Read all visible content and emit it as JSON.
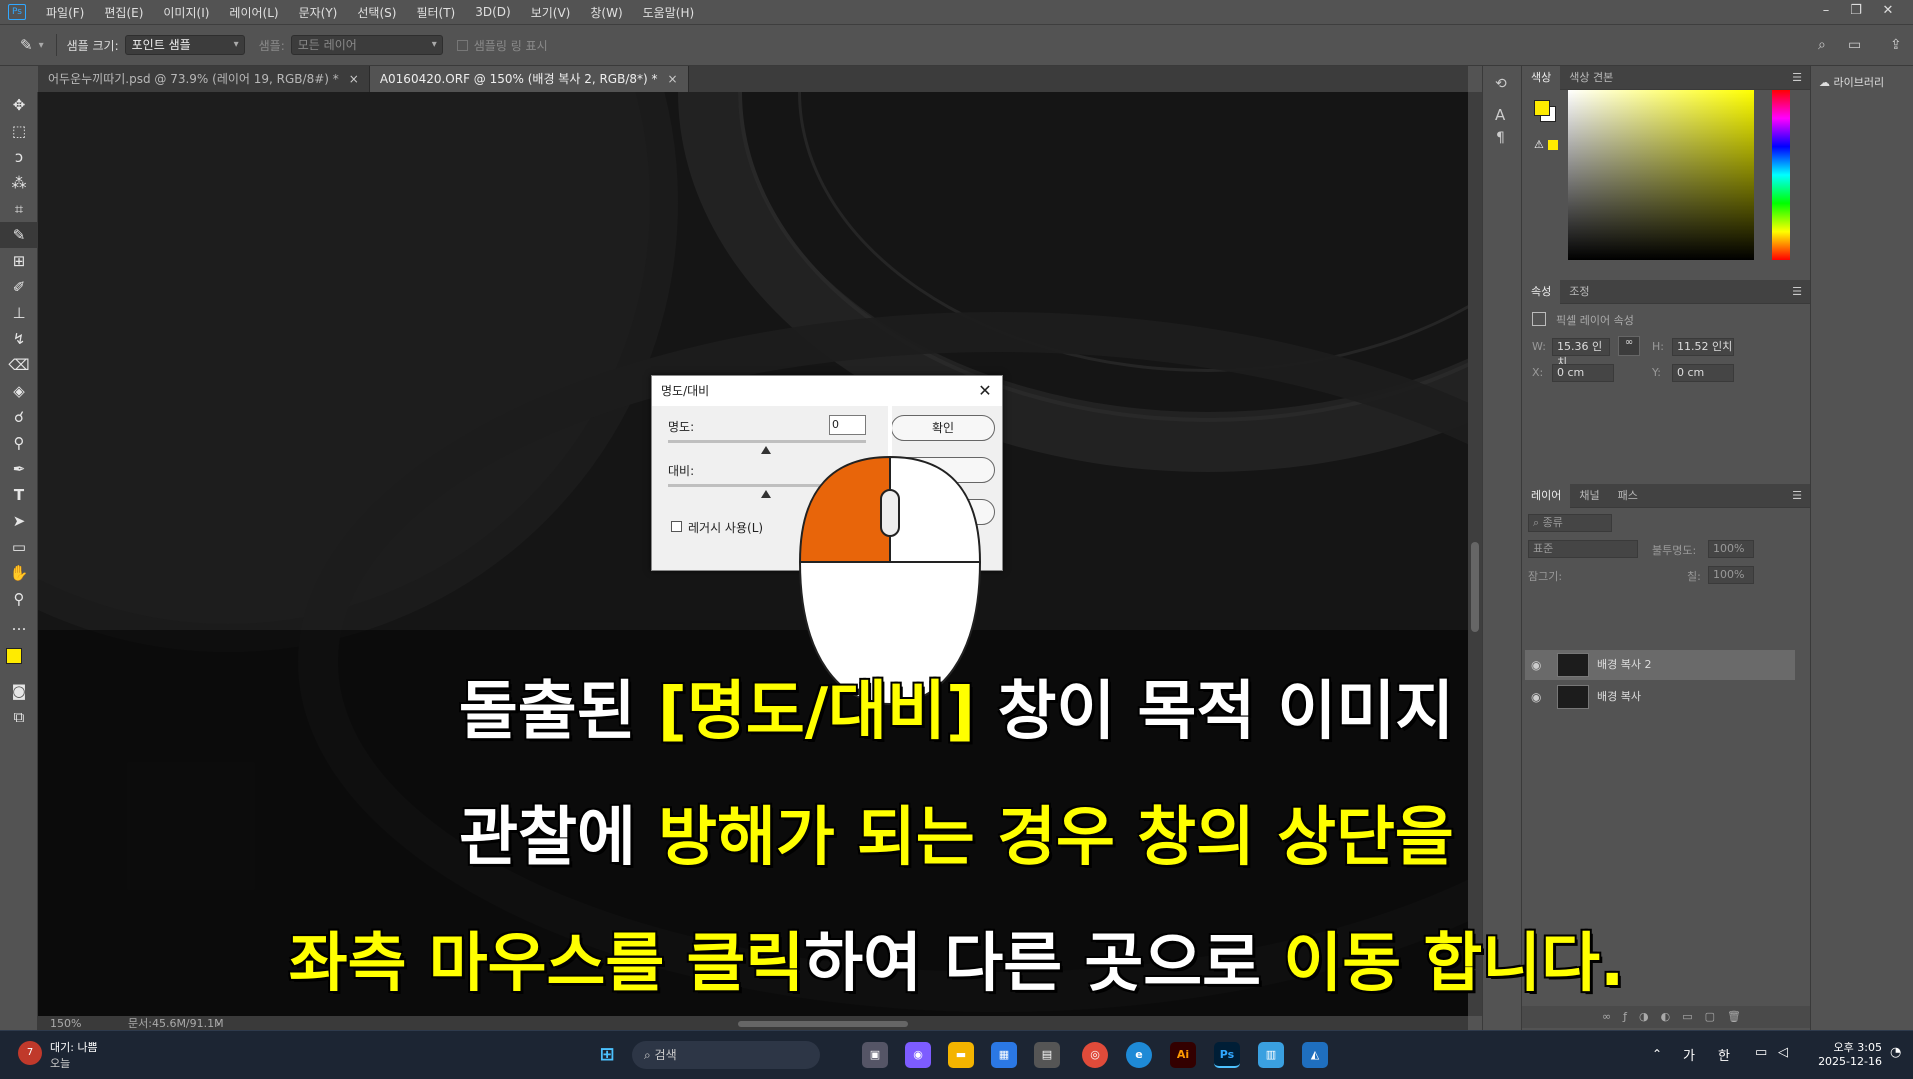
{
  "menubar": {
    "logo": "Ps",
    "items": [
      "파일(F)",
      "편집(E)",
      "이미지(I)",
      "레이어(L)",
      "문자(Y)",
      "선택(S)",
      "필터(T)",
      "3D(D)",
      "보기(V)",
      "창(W)",
      "도움말(H)"
    ]
  },
  "options": {
    "sample_size_label": "샘플 크기:",
    "sample_size_value": "포인트 샘플",
    "sample_label": "샘플:",
    "sample_value": "모든 레이어",
    "show_ring_label": "샘플링 링 표시"
  },
  "tabs": [
    {
      "label": "어두운누끼따기.psd @ 73.9% (레이어 19, RGB/8#) *"
    },
    {
      "label": "A0160420.ORF @ 150% (배경 복사 2, RGB/8*) *"
    }
  ],
  "status": {
    "zoom": "150%",
    "doc": "문서:45.6M/91.1M"
  },
  "color_panel": {
    "tabs": [
      "색상",
      "색상 견본"
    ],
    "foreground": "#ffeb00",
    "background": "#ffffff"
  },
  "properties_panel": {
    "tabs": [
      "속성",
      "조정"
    ],
    "title": "픽셀 레이어 속성",
    "w_label": "W:",
    "w_value": "15.36 인치",
    "h_label": "H:",
    "h_value": "11.52 인치",
    "x_label": "X:",
    "x_value": "0 cm",
    "y_label": "Y:",
    "y_value": "0 cm"
  },
  "layers_panel": {
    "tabs": [
      "레이어",
      "채널",
      "패스"
    ],
    "filter_label": "종류",
    "blend_mode": "표준",
    "opacity_label": "불투명도:",
    "opacity_value": "100%",
    "lock_label": "잠그기:",
    "fill_label": "칠:",
    "fill_value": "100%",
    "layers": [
      {
        "name": "배경 복사 2",
        "selected": true
      },
      {
        "name": "배경 복사",
        "selected": false
      }
    ]
  },
  "libraries": {
    "label": "라이브러리"
  },
  "dialog": {
    "title": "명도/대비",
    "brightness_label": "명도:",
    "brightness_value": "0",
    "contrast_label": "대비:",
    "ok_label": "확인",
    "legacy_label": "레거시 사용(L)"
  },
  "caption": {
    "line1_a": "돌출된 ",
    "line1_b": "[명도/대비]",
    "line1_c": " 창이 목적 이미지",
    "line2_a": "관찰에 ",
    "line2_b": "방해가 되는 경우 창의 상단을",
    "line3_a": "좌측 마우스를 클릭",
    "line3_b": "하여 다른 곳으로 ",
    "line3_c": "이동 합니다."
  },
  "taskbar": {
    "weather_badge": "7",
    "weather_line1": "대기: 나쁨",
    "weather_line2": "오늘",
    "search_placeholder": "검색",
    "ime1": "가",
    "ime2": "한",
    "time": "오후 3:05",
    "date": "2025-12-16"
  },
  "mouse_colors": {
    "left_button": "#e8650a",
    "body": "#ffffff"
  }
}
